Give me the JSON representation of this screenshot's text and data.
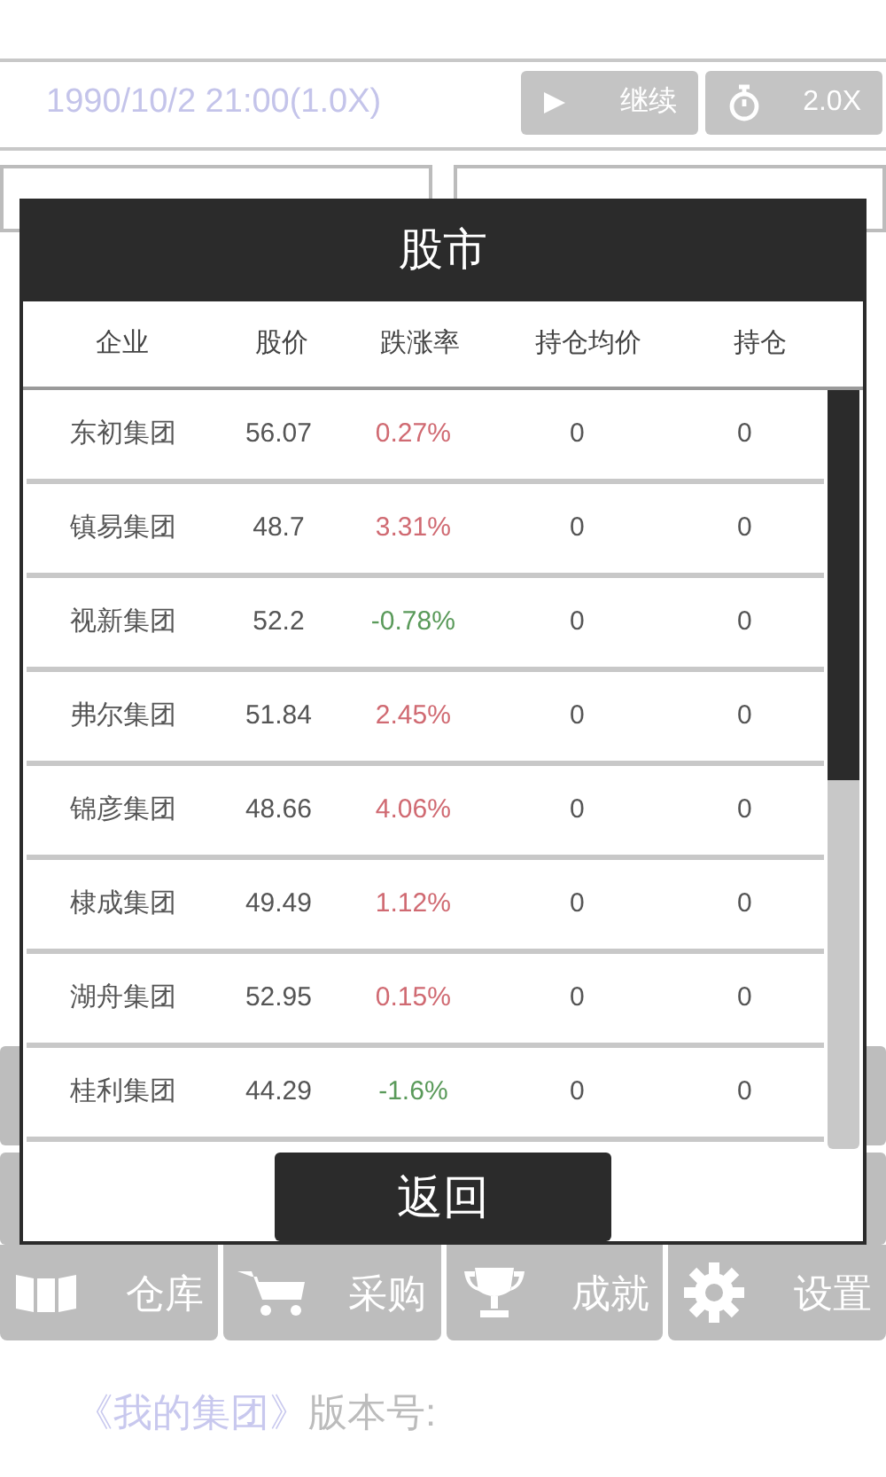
{
  "status": {
    "datetime": "1990/10/2 21:00(1.0X)",
    "buttons": [
      {
        "kind": "play",
        "label": "继续"
      },
      {
        "kind": "speed",
        "label": "2.0X"
      }
    ]
  },
  "modal": {
    "title": "股市",
    "columns": [
      "企业",
      "股价",
      "跌涨率",
      "持仓均价",
      "持仓"
    ],
    "rows": [
      {
        "company": "东初集团",
        "price": "56.07",
        "change": "0.27%",
        "falling": false,
        "avg": "0",
        "holding": "0"
      },
      {
        "company": "镇易集团",
        "price": "48.7",
        "change": "3.31%",
        "falling": false,
        "avg": "0",
        "holding": "0"
      },
      {
        "company": "视新集团",
        "price": "52.2",
        "change": "-0.78%",
        "falling": true,
        "avg": "0",
        "holding": "0"
      },
      {
        "company": "弗尔集团",
        "price": "51.84",
        "change": "2.45%",
        "falling": false,
        "avg": "0",
        "holding": "0"
      },
      {
        "company": "锦彦集团",
        "price": "48.66",
        "change": "4.06%",
        "falling": false,
        "avg": "0",
        "holding": "0"
      },
      {
        "company": "棣成集团",
        "price": "49.49",
        "change": "1.12%",
        "falling": false,
        "avg": "0",
        "holding": "0"
      },
      {
        "company": "湖舟集团",
        "price": "52.95",
        "change": "0.15%",
        "falling": false,
        "avg": "0",
        "holding": "0"
      },
      {
        "company": "桂利集团",
        "price": "44.29",
        "change": "-1.6%",
        "falling": true,
        "avg": "0",
        "holding": "0"
      }
    ],
    "back_button": "返回"
  },
  "nav": [
    {
      "kind": "book",
      "label": "仓库"
    },
    {
      "kind": "cart",
      "label": "采购"
    },
    {
      "kind": "trophy",
      "label": "成就"
    },
    {
      "kind": "gear",
      "label": "设置"
    }
  ],
  "footer": {
    "title": "《我的集团》",
    "version_label": "版本号:"
  }
}
